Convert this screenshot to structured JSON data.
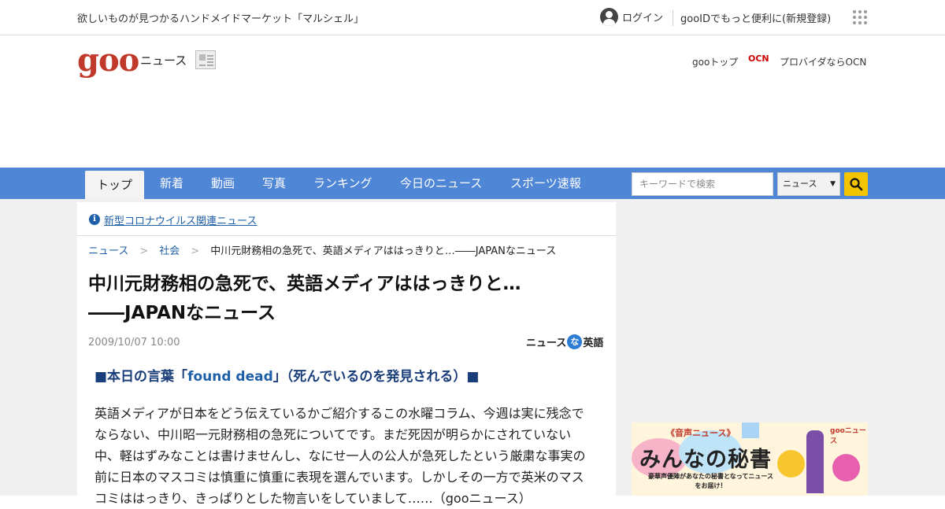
{
  "topbar": {
    "promo": "欲しいものが見つかるハンドメイドマーケット「マルシェル」",
    "login": "ログイン",
    "register": "gooIDでもっと便利に(新規登録)"
  },
  "header": {
    "logo": "goo",
    "section": "ニュース",
    "goo_top": "gooトップ",
    "ocn_mark": "OCN",
    "ocn": "プロバイダならOCN"
  },
  "nav": {
    "items": [
      "トップ",
      "新着",
      "動画",
      "写真",
      "ランキング",
      "今日のニュース",
      "スポーツ速報"
    ],
    "search_placeholder": "キーワードで検索",
    "search_scope": "ニュース"
  },
  "notice": "新型コロナウイルス関連ニュース",
  "breadcrumb": [
    "ニュース",
    "社会",
    "中川元財務相の急死で、英語メディアははっきりと…――JAPANなニュース"
  ],
  "article": {
    "title_line1": "中川元財務相の急死で、英語メディアははっきりと…",
    "title_line2": "――JAPANなニュース",
    "date": "2009/10/07 10:00",
    "source_left": "ニュース",
    "source_mid": "な",
    "source_right": "英語",
    "lead_prefix": "■本日の言葉「",
    "lead_em": "found dead",
    "lead_suffix": "」（死んでいるのを発見される）■",
    "body": "英語メディアが日本をどう伝えているかご紹介するこの水曜コラム、今週は実に残念でならない、中川昭一元財務相の急死についてです。まだ死因が明らかにされていない中、軽はずみなことは書けませんし、なにせ一人の公人が急死したという厳粛な事実の前に日本のマスコミは慎重に慎重に表現を選んでいます。しかしその一方で英米のマスコミははっきり、きっぱりとした物言いをしていまして……（gooニュース）"
  },
  "banner": {
    "tag": "《音声ニュース》",
    "brand": "gooニュース",
    "title": "みんなの秘書",
    "sub": "豪華声優陣があなたの秘書となってニュースをお届け！"
  }
}
